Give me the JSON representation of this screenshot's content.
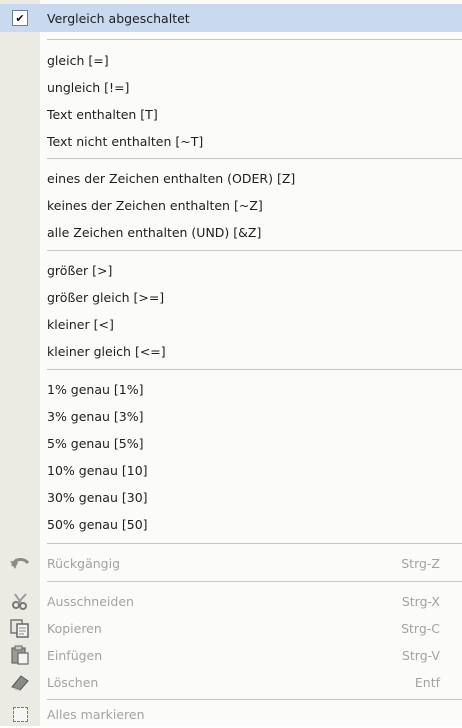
{
  "menu": {
    "header": {
      "label": "Vergleich abgeschaltet",
      "checked_glyph": "✔"
    },
    "group1": [
      {
        "label": "gleich [=]"
      },
      {
        "label": "ungleich [!=]"
      },
      {
        "label": "Text enthalten [T]"
      },
      {
        "label": "Text nicht enthalten [~T]"
      }
    ],
    "group2": [
      {
        "label": "eines der Zeichen enthalten (ODER) [Z]"
      },
      {
        "label": "keines der Zeichen enthalten [~Z]"
      },
      {
        "label": "alle Zeichen enthalten (UND) [&Z]"
      }
    ],
    "group3": [
      {
        "label": "größer [>]"
      },
      {
        "label": "größer gleich [>=]"
      },
      {
        "label": "kleiner [<]"
      },
      {
        "label": "kleiner gleich [<=]"
      }
    ],
    "group4": [
      {
        "label": "1% genau [1%]"
      },
      {
        "label": "3% genau [3%]"
      },
      {
        "label": "5% genau [5%]"
      },
      {
        "label": "10% genau [10]"
      },
      {
        "label": "30% genau [30]"
      },
      {
        "label": "50% genau [50]"
      }
    ],
    "edit": {
      "undo": {
        "label": "Rückgängig",
        "shortcut": "Strg-Z",
        "icon": "undo-icon"
      },
      "cut": {
        "label": "Ausschneiden",
        "shortcut": "Strg-X",
        "icon": "scissors-icon"
      },
      "copy": {
        "label": "Kopieren",
        "shortcut": "Strg-C",
        "icon": "copy-icon"
      },
      "paste": {
        "label": "Einfügen",
        "shortcut": "Strg-V",
        "icon": "paste-icon"
      },
      "delete": {
        "label": "Löschen",
        "shortcut": "Entf",
        "icon": "eraser-icon"
      },
      "select_all": {
        "label": "Alles markieren",
        "icon": "select-all-icon"
      }
    },
    "colors": {
      "highlight": "#c9d9ef",
      "gutter": "#ecebe3",
      "disabled_text": "#a4a39d"
    }
  }
}
